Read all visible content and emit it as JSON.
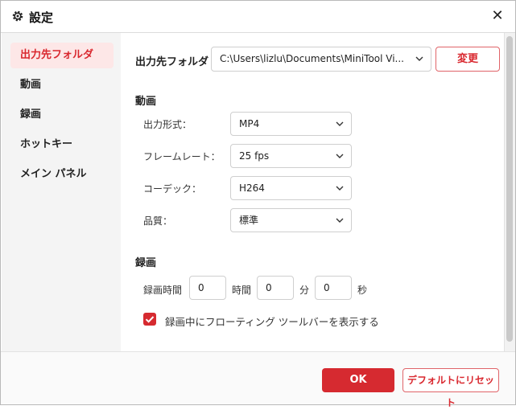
{
  "window": {
    "title": "設定",
    "title_icon": "gear-icon",
    "close_icon": "close-icon"
  },
  "sidebar": {
    "items": [
      {
        "label": "出力先フォルダ",
        "active": true
      },
      {
        "label": "動画",
        "active": false
      },
      {
        "label": "録画",
        "active": false
      },
      {
        "label": "ホットキー",
        "active": false
      },
      {
        "label": "メイン パネル",
        "active": false
      }
    ]
  },
  "output_folder": {
    "label": "出力先フォルダ",
    "path": "C:\\Users\\lizlu\\Documents\\MiniTool Vi...",
    "change_button": "変更"
  },
  "video": {
    "heading": "動画",
    "format_label": "出力形式：",
    "format_value": "MP4",
    "framerate_label": "フレームレート：",
    "framerate_value": "25 fps",
    "codec_label": "コーデック：",
    "codec_value": "H264",
    "quality_label": "品質：",
    "quality_value": "標準"
  },
  "recording": {
    "heading": "録画",
    "duration_label": "録画時間",
    "hours_value": "0",
    "hours_unit": "時間",
    "minutes_value": "0",
    "minutes_unit": "分",
    "seconds_value": "0",
    "seconds_unit": "秒",
    "floating_toolbar_label": "録画中にフローティング ツールバーを表示する",
    "floating_toolbar_checked": true
  },
  "footer": {
    "ok_button": "OK",
    "reset_button": "デフォルトにリセット"
  },
  "colors": {
    "accent": "#d62a30",
    "active_bg": "#fde7e7",
    "sidebar_bg": "#f4f4f4"
  }
}
